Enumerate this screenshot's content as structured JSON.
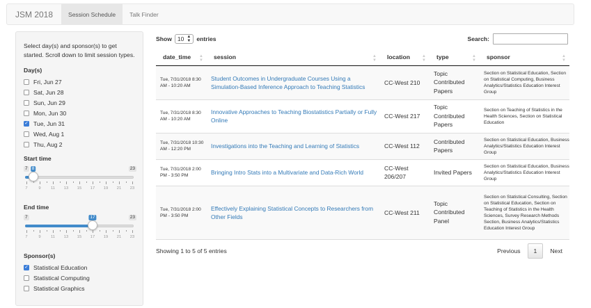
{
  "navbar": {
    "brand": "JSM 2018",
    "tabs": [
      {
        "label": "Session Schedule"
      },
      {
        "label": "Talk Finder"
      }
    ]
  },
  "sidebar": {
    "intro": "Select day(s) and sponsor(s) to get started. Scroll down to limit session types.",
    "days_label": "Day(s)",
    "days": [
      {
        "label": "Fri, Jun 27",
        "checked": false
      },
      {
        "label": "Sat, Jun 28",
        "checked": false
      },
      {
        "label": "Sun, Jun 29",
        "checked": false
      },
      {
        "label": "Mon, Jun 30",
        "checked": false
      },
      {
        "label": "Tue, Jun 31",
        "checked": true
      },
      {
        "label": "Wed, Aug 1",
        "checked": false
      },
      {
        "label": "Thu, Aug 2",
        "checked": false
      }
    ],
    "start_time": {
      "label": "Start time",
      "min_label": "7",
      "max_label": "23",
      "value_label": "8",
      "min": 7,
      "max": 23,
      "value": 8,
      "ticks": [
        "7",
        "9",
        "11",
        "13",
        "15",
        "17",
        "19",
        "21",
        "23"
      ]
    },
    "end_time": {
      "label": "End time",
      "min_label": "7",
      "max_label": "23",
      "value_label": "17",
      "min": 7,
      "max": 23,
      "value": 17,
      "ticks": [
        "7",
        "9",
        "11",
        "13",
        "15",
        "17",
        "19",
        "21",
        "23"
      ]
    },
    "sponsor_label": "Sponsor(s)",
    "sponsors": [
      {
        "label": "Statistical Education",
        "checked": true
      },
      {
        "label": "Statistical Computing",
        "checked": false
      },
      {
        "label": "Statistical Graphics",
        "checked": false
      }
    ]
  },
  "controls": {
    "show_label": "Show",
    "entries_value": "10",
    "entries_label": "entries",
    "search_label": "Search:",
    "search_value": ""
  },
  "table": {
    "columns": [
      "date_time",
      "session",
      "location",
      "type",
      "sponsor"
    ],
    "rows": [
      {
        "date_time": "Tue, 7/31/2018 8:30 AM - 10:20 AM",
        "session": "Student Outcomes in Undergraduate Courses Using a Simulation-Based Inference Approach to Teaching Statistics",
        "location": "CC-West 210",
        "type": "Topic Contributed Papers",
        "sponsor": "Section on Statistical Education, Section on Statistical Computing, Business Analytics/Statistics Education Interest Group"
      },
      {
        "date_time": "Tue, 7/31/2018 8:30 AM - 10:20 AM",
        "session": "Innovative Approaches to Teaching Biostatistics Partially or Fully Online",
        "location": "CC-West 217",
        "type": "Topic Contributed Papers",
        "sponsor": "Section on Teaching of Statistics in the Health Sciences, Section on Statistical Education"
      },
      {
        "date_time": "Tue, 7/31/2018 10:30 AM - 12:20 PM",
        "session": "Investigations into the Teaching and Learning of Statistics",
        "location": "CC-West 112",
        "type": "Contributed Papers",
        "sponsor": "Section on Statistical Education, Business Analytics/Statistics Education Interest Group"
      },
      {
        "date_time": "Tue, 7/31/2018 2:00 PM - 3:50 PM",
        "session": "Bringing Intro Stats into a Multivariate and Data-Rich World",
        "location": "CC-West 206/207",
        "type": "Invited Papers",
        "sponsor": "Section on Statistical Education, Business Analytics/Statistics Education Interest Group"
      },
      {
        "date_time": "Tue, 7/31/2018 2:00 PM - 3:50 PM",
        "session": "Effectively Explaining Statistical Concepts to Researchers from Other Fields",
        "location": "CC-West 211",
        "type": "Topic Contributed Panel",
        "sponsor": "Section on Statistical Consulting, Section on Statistical Education, Section on Teaching of Statistics in the Health Sciences, Survey Research Methods Section, Business Analytics/Statistics Education Interest Group"
      }
    ]
  },
  "footer": {
    "info": "Showing 1 to 5 of 5 entries",
    "previous": "Previous",
    "current_page": "1",
    "next": "Next"
  },
  "colors": {
    "accent": "#428bca",
    "link": "#337ab7",
    "checkbox_checked": "#3b7dd8"
  }
}
